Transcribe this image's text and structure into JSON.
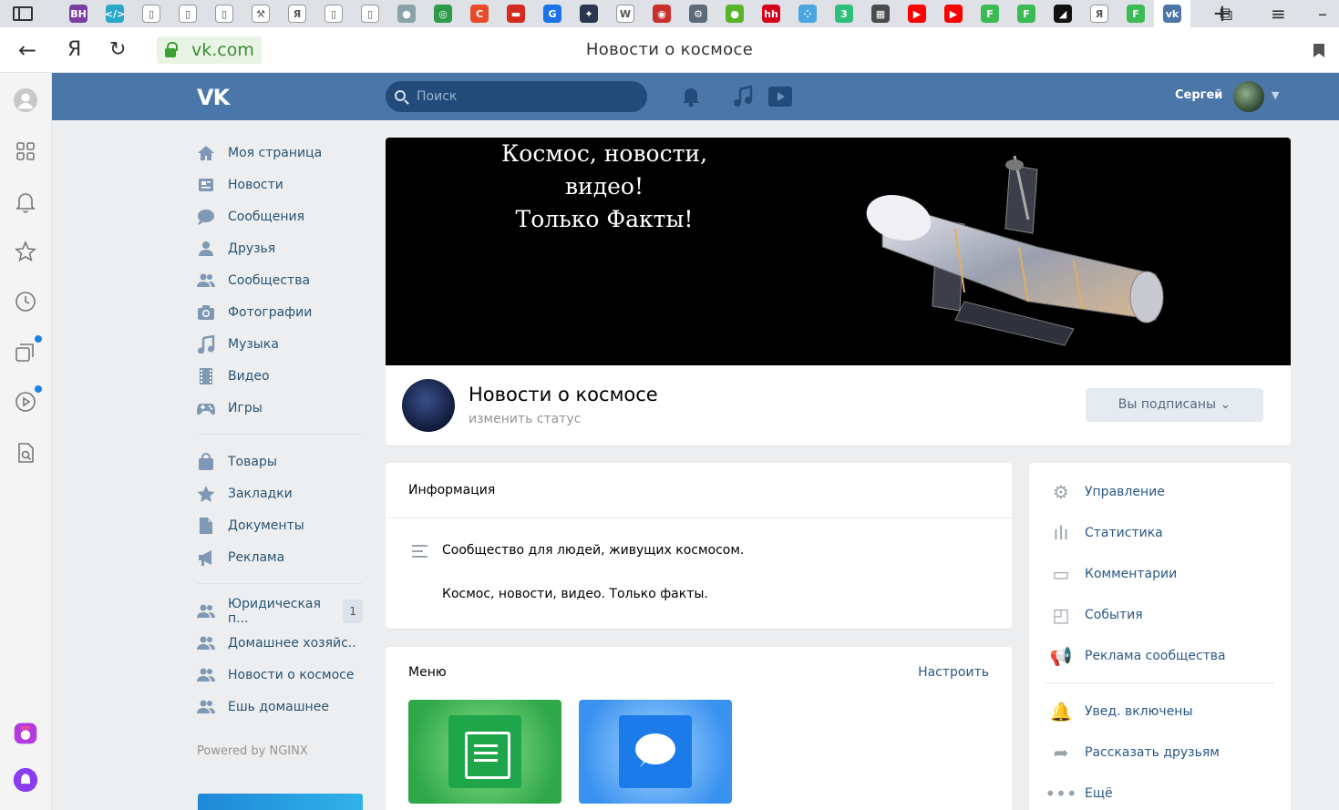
{
  "browser": {
    "tab_icons": [
      {
        "name": "tab-bh",
        "bg": "#7b3fa0",
        "glyph": "BH"
      },
      {
        "name": "tab-code",
        "bg": "#2aa8c9",
        "glyph": "</>"
      },
      {
        "name": "tab-doc1",
        "bg": "#ffffff",
        "glyph": "▯"
      },
      {
        "name": "tab-doc2",
        "bg": "#ffffff",
        "glyph": "▯"
      },
      {
        "name": "tab-doc3",
        "bg": "#ffffff",
        "glyph": "▯"
      },
      {
        "name": "tab-tool",
        "bg": "#ffffff",
        "glyph": "⚒"
      },
      {
        "name": "tab-yandex1",
        "bg": "#ffffff",
        "glyph": "Я"
      },
      {
        "name": "tab-doc4",
        "bg": "#ffffff",
        "glyph": "▯"
      },
      {
        "name": "tab-doc5",
        "bg": "#ffffff",
        "glyph": "▯"
      },
      {
        "name": "tab-figure",
        "bg": "#8aa2a8",
        "glyph": "●"
      },
      {
        "name": "tab-target",
        "bg": "#2e9a4a",
        "glyph": "◎"
      },
      {
        "name": "tab-c",
        "bg": "#e84a2a",
        "glyph": "C"
      },
      {
        "name": "tab-flag",
        "bg": "#d52b1e",
        "glyph": "▬"
      },
      {
        "name": "tab-google",
        "bg": "#1a73e8",
        "glyph": "G"
      },
      {
        "name": "tab-space",
        "bg": "#2b3550",
        "glyph": "✦"
      },
      {
        "name": "tab-wiki",
        "bg": "#ffffff",
        "glyph": "W"
      },
      {
        "name": "tab-red",
        "bg": "#c9302c",
        "glyph": "◉"
      },
      {
        "name": "tab-ext",
        "bg": "#5c6b7a",
        "glyph": "⚙"
      },
      {
        "name": "tab-apple",
        "bg": "#58b52a",
        "glyph": "●"
      },
      {
        "name": "tab-hh",
        "bg": "#d6001c",
        "glyph": "hh"
      },
      {
        "name": "tab-dots",
        "bg": "#4aa5e0",
        "glyph": "⁘"
      },
      {
        "name": "tab-three",
        "bg": "#2cc07a",
        "glyph": "3"
      },
      {
        "name": "tab-photo",
        "bg": "#4a4a4a",
        "glyph": "▦"
      },
      {
        "name": "tab-youtube1",
        "bg": "#ff0000",
        "glyph": "▶"
      },
      {
        "name": "tab-youtube2",
        "bg": "#ff0000",
        "glyph": "▶"
      },
      {
        "name": "tab-f1",
        "bg": "#3cba54",
        "glyph": "F"
      },
      {
        "name": "tab-f2",
        "bg": "#3cba54",
        "glyph": "F"
      },
      {
        "name": "tab-dark",
        "bg": "#111111",
        "glyph": "◢"
      },
      {
        "name": "tab-yandex2",
        "bg": "#ffffff",
        "glyph": "Я"
      },
      {
        "name": "tab-f3",
        "bg": "#3cba54",
        "glyph": "F"
      },
      {
        "name": "tab-vk",
        "bg": "#4a76a8",
        "glyph": "vk"
      }
    ],
    "new_tab": "+",
    "domain": "vk.com",
    "page_title": "Новости о космосе"
  },
  "header": {
    "logo": "VK",
    "search_placeholder": "Поиск",
    "user_name": "Сергей"
  },
  "left_menu": {
    "main": [
      {
        "label": "Моя страница",
        "icon": "home-icon"
      },
      {
        "label": "Новости",
        "icon": "news-icon"
      },
      {
        "label": "Сообщения",
        "icon": "messages-icon"
      },
      {
        "label": "Друзья",
        "icon": "friends-icon"
      },
      {
        "label": "Сообщества",
        "icon": "communities-icon"
      },
      {
        "label": "Фотографии",
        "icon": "camera-icon"
      },
      {
        "label": "Музыка",
        "icon": "music-icon"
      },
      {
        "label": "Видео",
        "icon": "video-icon"
      },
      {
        "label": "Игры",
        "icon": "gamepad-icon"
      }
    ],
    "secondary": [
      {
        "label": "Товары",
        "icon": "bag-icon"
      },
      {
        "label": "Закладки",
        "icon": "star-icon"
      },
      {
        "label": "Документы",
        "icon": "document-icon"
      },
      {
        "label": "Реклама",
        "icon": "megaphone-icon"
      }
    ],
    "groups": [
      {
        "label": "Юридическая п...",
        "counter": "1"
      },
      {
        "label": "Домашнее хозяйс..",
        "counter": ""
      },
      {
        "label": "Новости о космосе",
        "counter": ""
      },
      {
        "label": "Ешь домашнее",
        "counter": ""
      }
    ],
    "powered_by": "Powered by NGINX"
  },
  "cover": {
    "line1": "Космос, новости,",
    "line2": "видео!",
    "line3": "Только Факты!"
  },
  "group": {
    "name": "Новости о космосе",
    "status": "изменить статус",
    "subscribe_label": "Вы подписаны ⌄"
  },
  "info": {
    "title": "Информация",
    "desc1": "Сообщество для людей, живущих космосом.",
    "desc2": "Космос, новости, видео. Только факты."
  },
  "menu_block": {
    "title": "Меню",
    "configure": "Настроить"
  },
  "admin": {
    "items": [
      {
        "label": "Управление",
        "icon": "gear-icon",
        "glyph": "⚙"
      },
      {
        "label": "Статистика",
        "icon": "stats-icon",
        "glyph": "ılı"
      },
      {
        "label": "Комментарии",
        "icon": "comment-icon",
        "glyph": "▭"
      },
      {
        "label": "События",
        "icon": "events-icon",
        "glyph": "◰"
      },
      {
        "label": "Реклама сообщества",
        "icon": "megaphone-icon",
        "glyph": "📢"
      }
    ],
    "items2": [
      {
        "label": "Увед. включены",
        "icon": "bell-check-icon",
        "glyph": "🔔"
      },
      {
        "label": "Рассказать друзьям",
        "icon": "share-icon",
        "glyph": "➦"
      },
      {
        "label": "Ещё",
        "icon": "more-icon",
        "glyph": "•••"
      }
    ]
  },
  "colors": {
    "vk_blue": "#4a76a8",
    "link": "#2a5885"
  }
}
